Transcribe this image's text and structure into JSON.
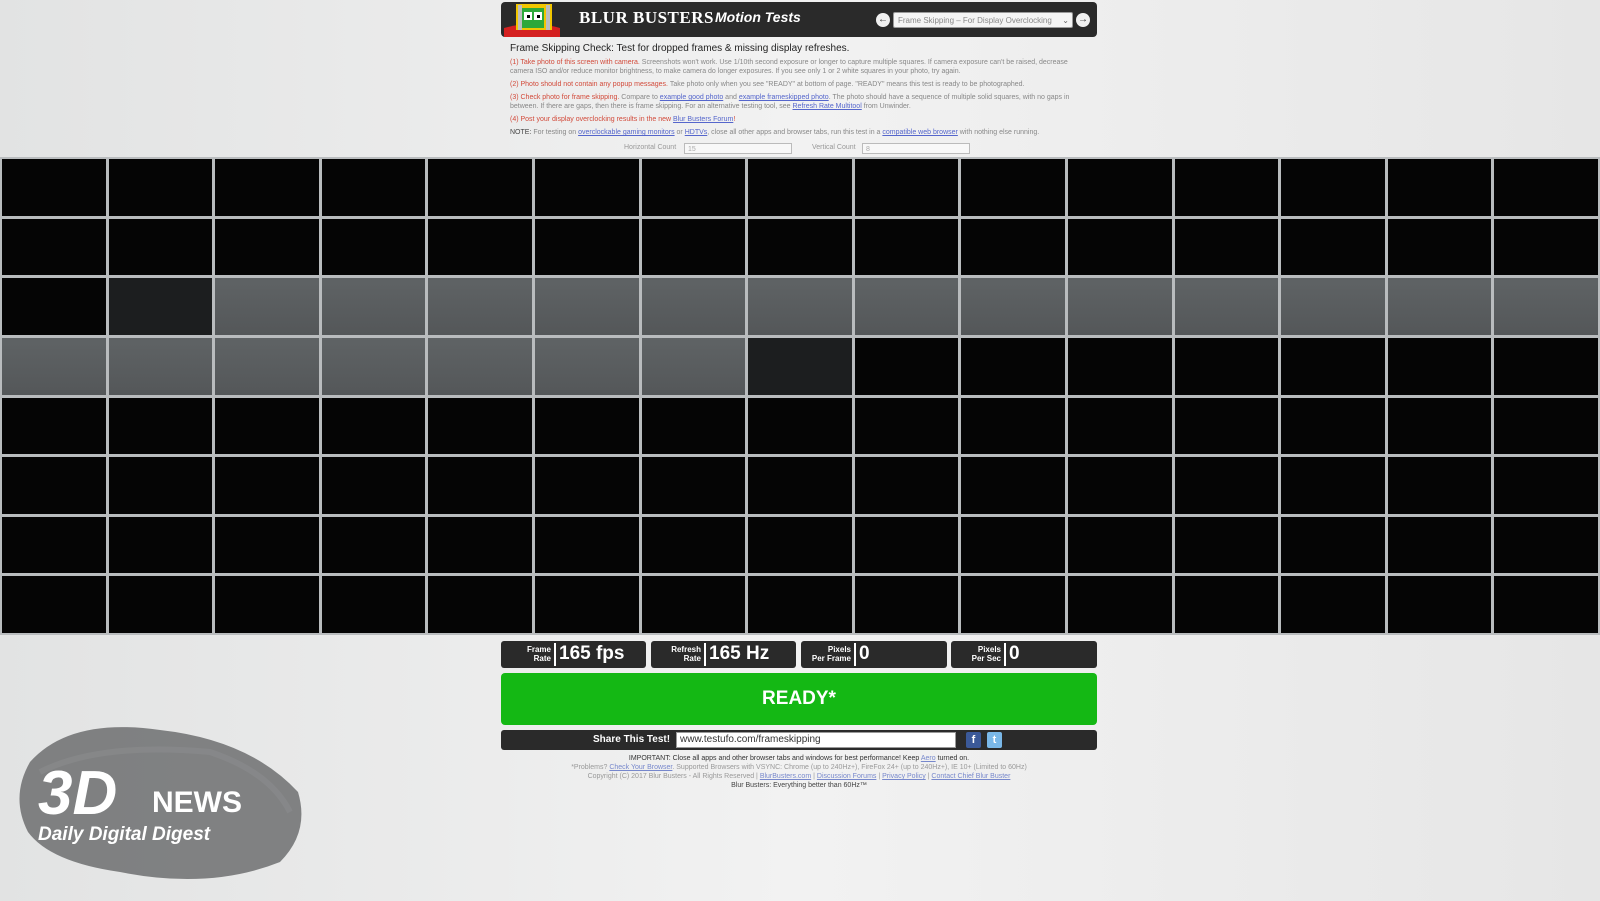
{
  "header": {
    "brand": "BLUR BUSTERS",
    "brand_sub": "Motion Tests",
    "test_select": "Frame Skipping – For Display Overclocking"
  },
  "intro": {
    "title": "Frame Skipping Check: Test for dropped frames & missing display refreshes.",
    "step1_red": "(1) Take photo of this screen with camera.",
    "step1_rest": " Screenshots won't work. Use 1/10th second exposure or longer to capture multiple squares. If camera exposure can't be raised, decrease camera ISO and/or reduce monitor brightness, to make camera do longer exposures. If you see only 1 or 2 white squares in your photo, try again.",
    "step2_red": "(2) Photo should not contain any popup messages.",
    "step2_rest": " Take photo only when you see \"READY\" at bottom of page. \"READY\" means this test is ready to be photographed.",
    "step3_red": "(3) Check photo for frame skipping.",
    "step3_a": " Compare to ",
    "step3_link1": "example good photo",
    "step3_b": " and ",
    "step3_link2": "example frameskipped photo",
    "step3_c": ". The photo should have a sequence of multiple solid squares, with no gaps in between. If there are gaps, then there is frame skipping. For an alternative testing tool, see ",
    "step3_link3": "Refresh Rate Multitool",
    "step3_d": " from Unwinder.",
    "step4_red": "(4) Post your display overclocking results",
    "step4_a": " in the new ",
    "step4_link": "Blur Busters Forum",
    "step4_b": "!",
    "note_label": "NOTE:",
    "note_a": " For testing on ",
    "note_link1": "overclockable gaming monitors",
    "note_b": " or ",
    "note_link2": "HDTVs",
    "note_c": ", close all other apps and browser tabs, run this test in a ",
    "note_link3": "compatible web browser",
    "note_d": " with nothing else running."
  },
  "counts": {
    "horizontal_label": "Horizontal Count",
    "horizontal_value": "15",
    "vertical_label": "Vertical Count",
    "vertical_value": "8"
  },
  "grid": {
    "columns": 15,
    "rows": 8,
    "lit_cells": [
      [
        2,
        2
      ],
      [
        2,
        3
      ],
      [
        2,
        4
      ],
      [
        2,
        5
      ],
      [
        2,
        6
      ],
      [
        2,
        7
      ],
      [
        2,
        8
      ],
      [
        2,
        9
      ],
      [
        2,
        10
      ],
      [
        2,
        11
      ],
      [
        2,
        12
      ],
      [
        2,
        13
      ],
      [
        2,
        14
      ],
      [
        3,
        0
      ],
      [
        3,
        1
      ],
      [
        3,
        2
      ],
      [
        3,
        3
      ],
      [
        3,
        4
      ],
      [
        3,
        5
      ],
      [
        3,
        6
      ]
    ],
    "dim_cells": [
      [
        2,
        1
      ],
      [
        3,
        7
      ]
    ]
  },
  "stats": {
    "frame_rate_label_1": "Frame",
    "frame_rate_label_2": "Rate",
    "frame_rate_value": "165 fps",
    "refresh_label_1": "Refresh",
    "refresh_label_2": "Rate",
    "refresh_value": "165 Hz",
    "ppf_label_1": "Pixels",
    "ppf_label_2": "Per Frame",
    "ppf_value": "0",
    "pps_label_1": "Pixels",
    "pps_label_2": "Per Sec",
    "pps_value": "0"
  },
  "ready": "READY*",
  "share": {
    "label": "Share This Test!",
    "url": "www.testufo.com/frameskipping",
    "facebook": "f",
    "twitter": "t"
  },
  "footer": {
    "line1_a": "IMPORTANT: Close all apps and other browser tabs and windows for best performance! Keep ",
    "line1_link": "Aero",
    "line1_b": " turned on.",
    "line2_a": "*Problems? ",
    "line2_link": "Check Your Browser",
    "line2_b": ". Supported Browsers with VSYNC: Chrome (up to 240Hz+), FireFox 24+ (up to 240Hz+), IE 10+ (Limited to 60Hz)",
    "line3_a": "Copyright (C) 2017 Blur Busters - All Rights Reserved | ",
    "line3_link1": "BlurBusters.com",
    "line3_sep1": " | ",
    "line3_link2": "Discussion Forums",
    "line3_sep2": " | ",
    "line3_link3": "Privacy Policy",
    "line3_sep3": " | ",
    "line3_link4": "Contact Chief Blur Buster",
    "tagline": "Blur Busters: Everything better than 60Hz™"
  },
  "watermark": {
    "logo": "3D",
    "word": "NEWS",
    "tagline": "Daily Digital Digest"
  },
  "colors": {
    "ready_green": "#14b814",
    "header_dark": "#2a2a2a",
    "step_red": "#d24a3a",
    "link_blue": "#5566cc"
  }
}
